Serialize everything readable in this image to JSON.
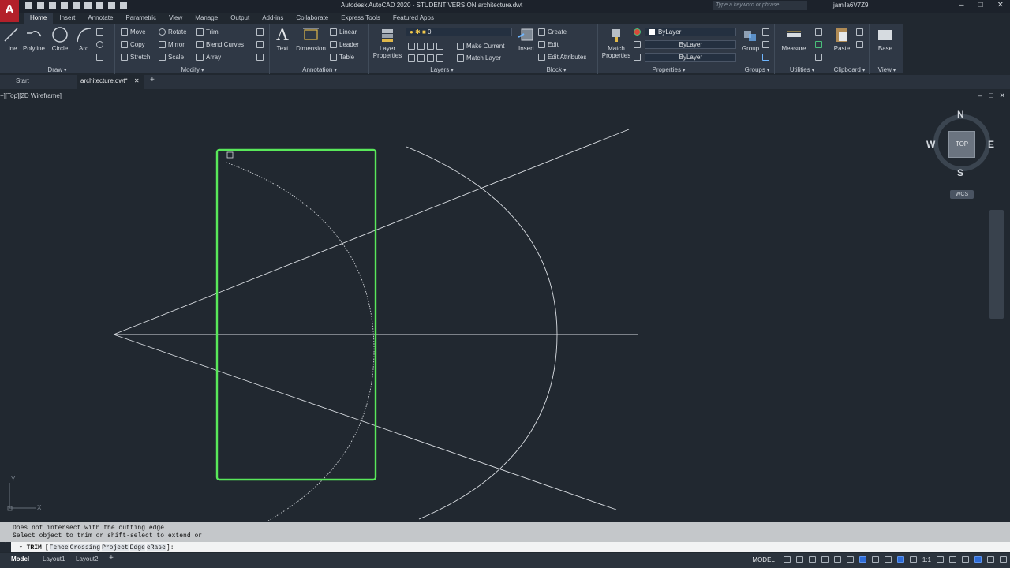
{
  "app": {
    "logo": "A",
    "title": "Autodesk AutoCAD 2020 - STUDENT VERSION     architecture.dwt"
  },
  "search": {
    "placeholder": "Type a keyword or phrase"
  },
  "user": {
    "name": "jamila6V7Z9"
  },
  "window_controls": [
    "–",
    "□",
    "✕"
  ],
  "ribbon_tabs": [
    "Home",
    "Insert",
    "Annotate",
    "Parametric",
    "View",
    "Manage",
    "Output",
    "Add-ins",
    "Collaborate",
    "Express Tools",
    "Featured Apps"
  ],
  "active_tab": "Home",
  "draw": {
    "title": "Draw",
    "line": "Line",
    "polyline": "Polyline",
    "circle": "Circle",
    "arc": "Arc"
  },
  "modify": {
    "title": "Modify",
    "move": "Move",
    "rotate": "Rotate",
    "trim": "Trim",
    "copy": "Copy",
    "mirror": "Mirror",
    "blend": "Blend Curves",
    "stretch": "Stretch",
    "scale": "Scale",
    "array": "Array"
  },
  "annotation": {
    "title": "Annotation",
    "text": "Text",
    "dimension": "Dimension",
    "linear": "Linear",
    "leader": "Leader",
    "table": "Table"
  },
  "layers": {
    "title": "Layers",
    "layer_properties": "Layer Properties",
    "current_layer": "0",
    "make_current": "Make Current",
    "match_layer": "Match Layer"
  },
  "block": {
    "title": "Block",
    "insert": "Insert",
    "create": "Create",
    "edit": "Edit",
    "edit_attributes": "Edit Attributes"
  },
  "properties": {
    "title": "Properties",
    "match": "Match Properties",
    "color": "ByLayer",
    "linetype": "ByLayer",
    "lineweight": "ByLayer"
  },
  "groups": {
    "title": "Groups",
    "group": "Group"
  },
  "utilities": {
    "title": "Utilities",
    "measure": "Measure"
  },
  "clipboard": {
    "title": "Clipboard",
    "paste": "Paste"
  },
  "view": {
    "title": "View",
    "base": "Base"
  },
  "doc_tabs": {
    "start": "Start",
    "file": "architecture.dwt*",
    "close": "✕",
    "new": "+"
  },
  "viewport": {
    "label": "−][Top][2D Wireframe]",
    "controls": [
      "–",
      "□",
      "✕"
    ]
  },
  "viewcube": {
    "north": "N",
    "south": "S",
    "east": "E",
    "west": "W",
    "face": "TOP",
    "wcs": "WCS"
  },
  "ucs": {
    "x": "X",
    "y": "Y"
  },
  "command": {
    "history": [
      "Does not intersect with the cutting edge.",
      "Select object to trim or shift-select to extend or"
    ],
    "current": "TRIM",
    "prompt_open": "[",
    "options": [
      "Fence",
      "Crossing",
      "Project",
      "Edge",
      "eRase"
    ],
    "prompt_close": "]:"
  },
  "layout_tabs": {
    "model": "Model",
    "layout1": "Layout1",
    "layout2": "Layout2",
    "add": "+"
  },
  "status": {
    "model": "MODEL",
    "scale": "1:1"
  },
  "colors": {
    "selection": "#59e85a",
    "geometry": "#d9dde2",
    "background": "#212830"
  }
}
